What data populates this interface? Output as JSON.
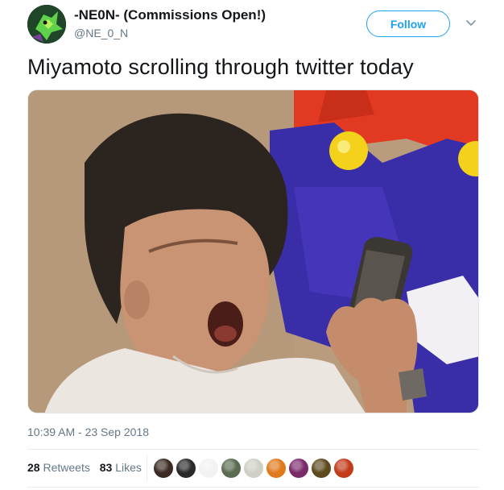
{
  "author": {
    "name": "-NE0N- (Commissions Open!)",
    "handle": "@NE_0_N"
  },
  "actions": {
    "follow_label": "Follow"
  },
  "tweet": {
    "text": "Miyamoto scrolling through twitter today",
    "timestamp": "10:39 AM - 23 Sep 2018"
  },
  "stats": {
    "retweets_count": "28",
    "retweets_label": "Retweets",
    "likes_count": "83",
    "likes_label": "Likes"
  },
  "likers": [
    {
      "color": "#3b2b22"
    },
    {
      "color": "#2a2a2a"
    },
    {
      "color": "#f2f2f2"
    },
    {
      "color": "#5a6b52"
    },
    {
      "color": "#cfcfc6"
    },
    {
      "color": "#e07a1c"
    },
    {
      "color": "#7a2a6a"
    },
    {
      "color": "#5e4a1d"
    },
    {
      "color": "#c23b1a"
    }
  ],
  "colors": {
    "accent": "#1da1f2",
    "text_secondary": "#657786"
  }
}
